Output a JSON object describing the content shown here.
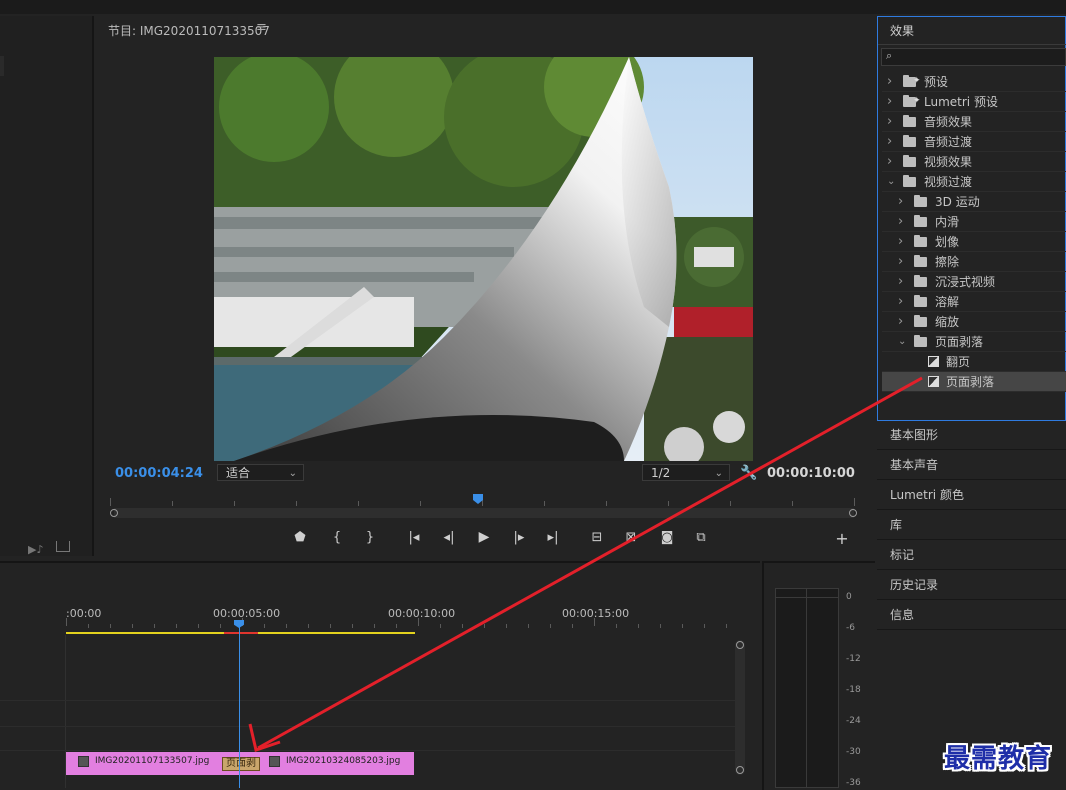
{
  "program_monitor": {
    "title": "节目: IMG20201107133507",
    "menu_icon": "≡",
    "timecode_current": "00:00:04:24",
    "timecode_duration": "00:00:10:00",
    "zoom_select": "适合",
    "resolution_select": "1/2",
    "playhead_fraction": 0.49,
    "controls": [
      "marker-icon",
      "in-point-icon",
      "out-point-icon",
      "go-to-in-icon",
      "step-back-icon",
      "play-icon",
      "step-forward-icon",
      "go-to-out-icon",
      "lift-icon",
      "extract-icon",
      "camera-icon",
      "compare-icon",
      "add-icon"
    ]
  },
  "effects_panel": {
    "title": "效果",
    "search_placeholder": "",
    "tree": [
      {
        "label": "预设",
        "level": 0,
        "icon": "preset-folder",
        "expanded": false
      },
      {
        "label": "Lumetri 预设",
        "level": 0,
        "icon": "preset-folder",
        "expanded": false
      },
      {
        "label": "音频效果",
        "level": 0,
        "icon": "folder",
        "expanded": false
      },
      {
        "label": "音频过渡",
        "level": 0,
        "icon": "folder",
        "expanded": false
      },
      {
        "label": "视频效果",
        "level": 0,
        "icon": "folder",
        "expanded": false
      },
      {
        "label": "视频过渡",
        "level": 0,
        "icon": "folder",
        "expanded": true
      },
      {
        "label": "3D 运动",
        "level": 1,
        "icon": "folder",
        "expanded": false
      },
      {
        "label": "内滑",
        "level": 1,
        "icon": "folder",
        "expanded": false
      },
      {
        "label": "划像",
        "level": 1,
        "icon": "folder",
        "expanded": false
      },
      {
        "label": "擦除",
        "level": 1,
        "icon": "folder",
        "expanded": false
      },
      {
        "label": "沉浸式视频",
        "level": 1,
        "icon": "folder",
        "expanded": false
      },
      {
        "label": "溶解",
        "level": 1,
        "icon": "folder",
        "expanded": false
      },
      {
        "label": "缩放",
        "level": 1,
        "icon": "folder",
        "expanded": false
      },
      {
        "label": "页面剥落",
        "level": 1,
        "icon": "folder",
        "expanded": true
      },
      {
        "label": "翻页",
        "level": 2,
        "icon": "transition",
        "expanded": false
      },
      {
        "label": "页面剥落",
        "level": 2,
        "icon": "transition",
        "expanded": false,
        "selected": true
      }
    ]
  },
  "side_panels": [
    "基本图形",
    "基本声音",
    "Lumetri 颜色",
    "库",
    "标记",
    "历史记录",
    "信息"
  ],
  "timeline": {
    "ruler_labels": [
      ":00:00",
      "00:00:05:00",
      "00:00:10:00",
      "00:00:15:00"
    ],
    "clips": [
      {
        "name": "IMG20201107133507.jpg"
      },
      {
        "name": "IMG20210324085203.jpg"
      }
    ],
    "transition_label": "页面剥"
  },
  "audio_meter": {
    "scale": [
      "0",
      "-6",
      "-12",
      "-18",
      "-24",
      "-30",
      "-36"
    ]
  },
  "watermark": "最需教育",
  "colors": {
    "accent_blue": "#3a8fe8",
    "clip_pink": "#e27fe0",
    "annotation_red": "#e3202a",
    "work_area_yellow": "#e3d21e"
  }
}
